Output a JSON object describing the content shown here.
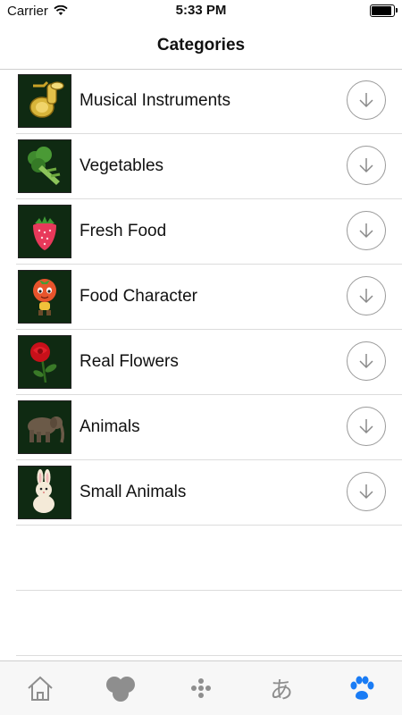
{
  "status": {
    "carrier": "Carrier",
    "time": "5:33 PM",
    "battery_level": 1.0
  },
  "nav": {
    "title": "Categories"
  },
  "categories": [
    {
      "label": "Musical Instruments",
      "icon": "tuba-icon"
    },
    {
      "label": "Vegetables",
      "icon": "broccoli-icon"
    },
    {
      "label": "Fresh Food",
      "icon": "strawberry-icon"
    },
    {
      "label": "Food Character",
      "icon": "tomato-character-icon"
    },
    {
      "label": "Real Flowers",
      "icon": "rose-icon"
    },
    {
      "label": "Animals",
      "icon": "elephant-icon"
    },
    {
      "label": "Small Animals",
      "icon": "rabbit-icon"
    }
  ],
  "tabbar": {
    "tabs": [
      {
        "name": "home",
        "icon": "home-icon"
      },
      {
        "name": "circles",
        "icon": "circles-icon"
      },
      {
        "name": "dots",
        "icon": "dots-icon"
      },
      {
        "name": "kana",
        "icon": "hiragana-icon",
        "glyph": "あ"
      },
      {
        "name": "paw",
        "icon": "paw-icon",
        "active": true
      }
    ],
    "active_color": "#1a7cf5",
    "inactive_color": "#8e8e8e"
  }
}
